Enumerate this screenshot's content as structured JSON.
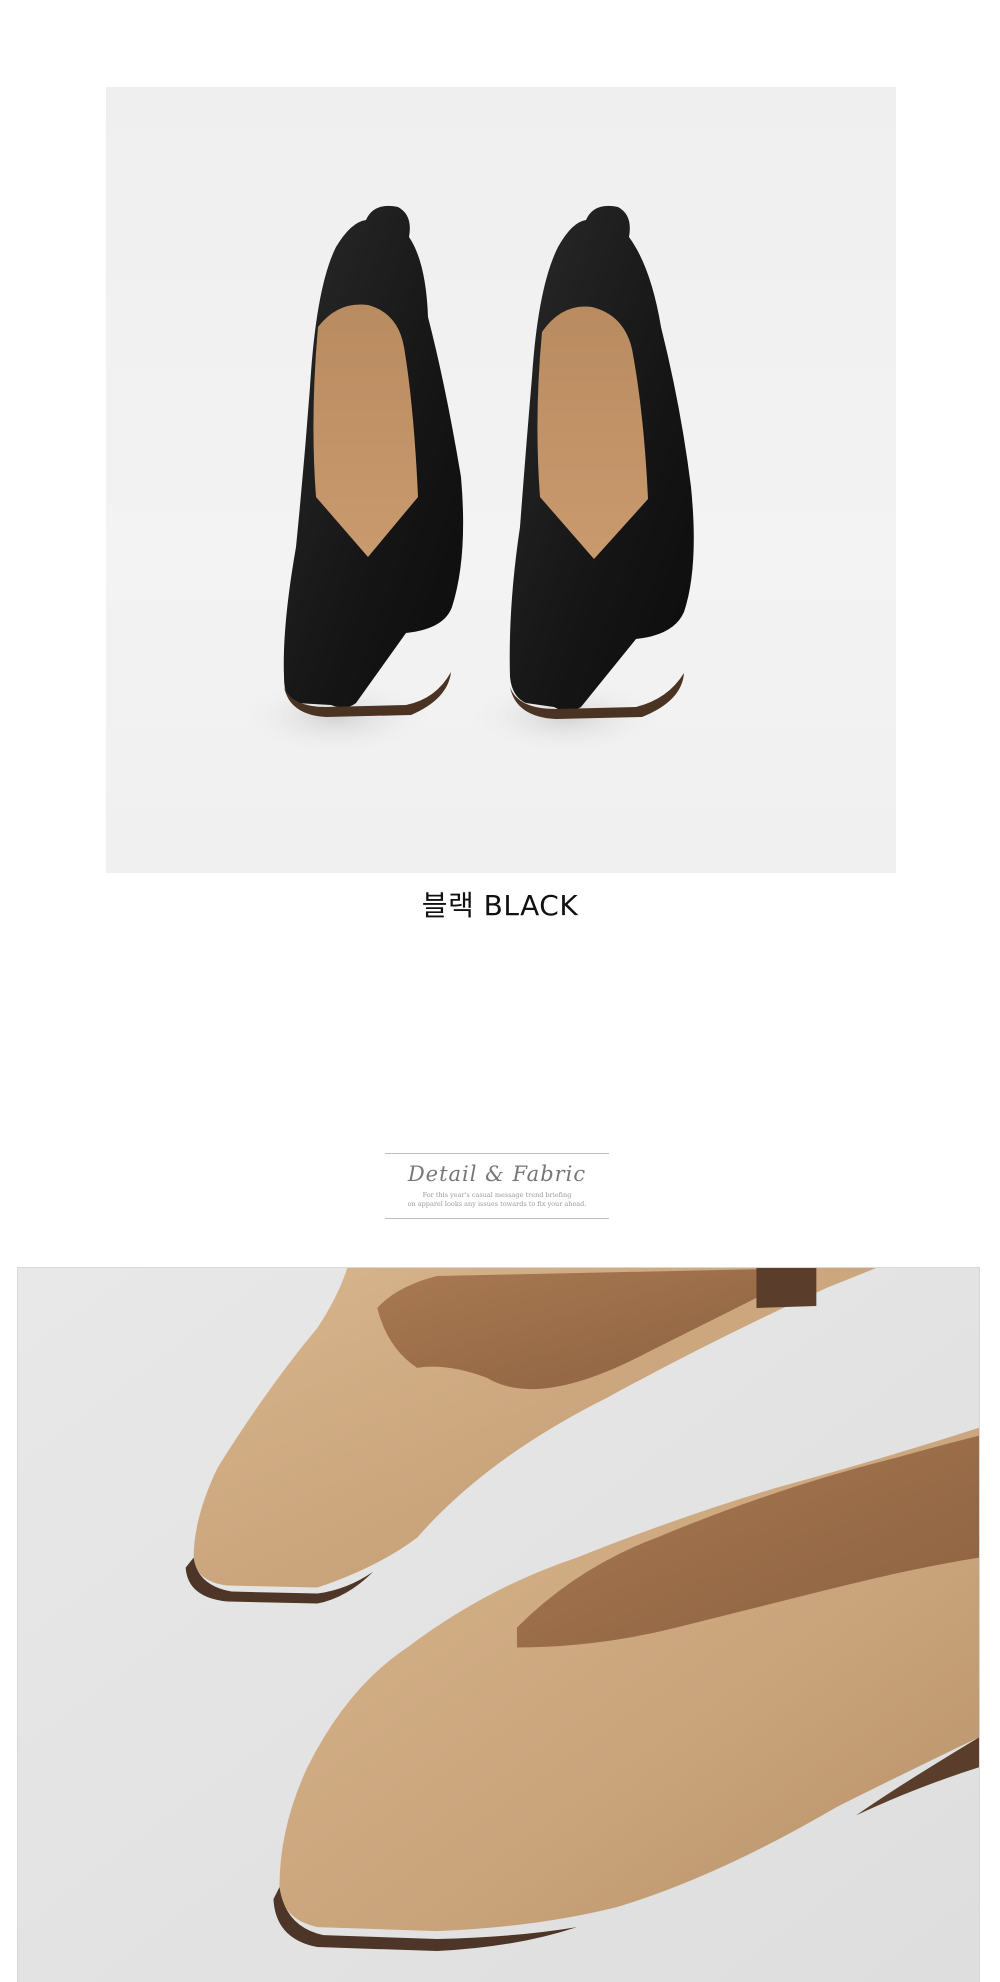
{
  "top_photo": {
    "subject": "black-flats-top-view"
  },
  "color_label": "블랙 BLACK",
  "section_header": {
    "title": "Detail & Fabric",
    "sub_line_1": "For this year's casual message trend briefing",
    "sub_line_2": "on apparel looks any issues towards to fix your ahead."
  },
  "bottom_photo": {
    "subject": "beige-flats-detail-closeup"
  }
}
